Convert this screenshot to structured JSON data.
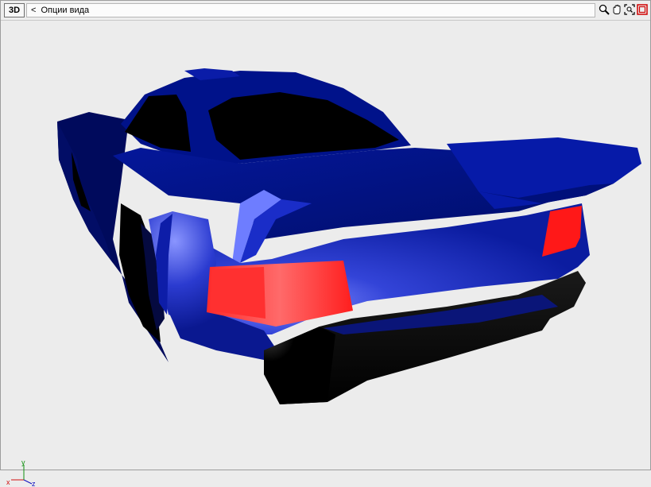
{
  "toolbar": {
    "mode_badge": "3D",
    "back_label": "<",
    "title": "Опции вида",
    "icons": [
      "zoom-icon",
      "pan-hand-icon",
      "fit-view-icon",
      "maximize-icon"
    ]
  },
  "viewport": {
    "model_name": "",
    "colors": {
      "background": "#ececec",
      "body": "#00108a",
      "highlight": "#5a68f0",
      "tail_light": "#ff2020",
      "shadow": "#000000"
    }
  },
  "axes": {
    "x_label": "x",
    "y_label": "y",
    "z_label": "z",
    "x_color": "#d01010",
    "y_color": "#109010",
    "z_color": "#1010c0"
  }
}
